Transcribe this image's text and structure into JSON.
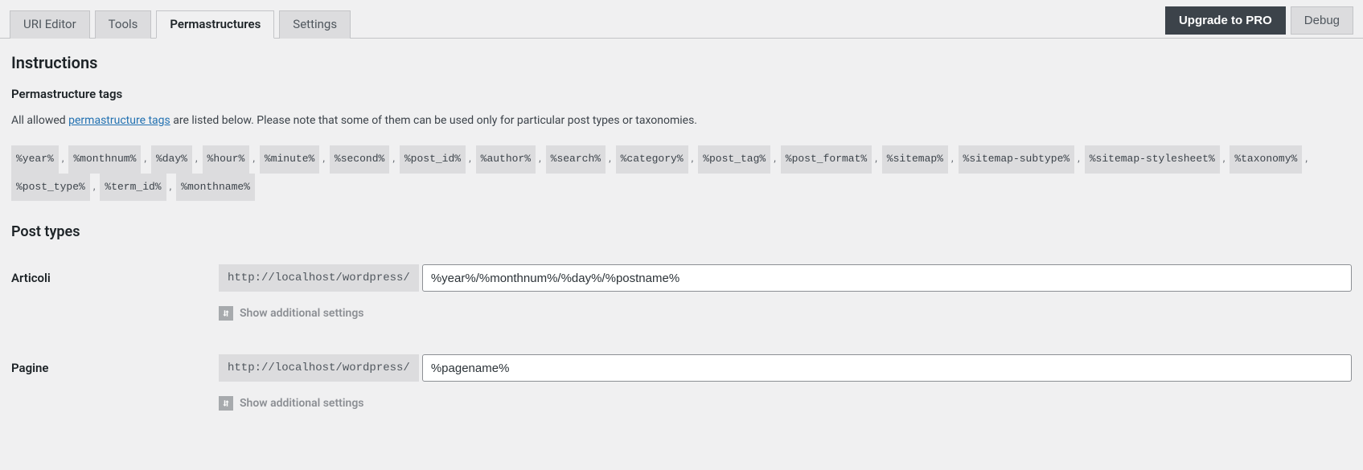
{
  "tabs": {
    "left": [
      "URI Editor",
      "Tools",
      "Permastructures",
      "Settings"
    ],
    "active_index": 2,
    "upgrade": "Upgrade to PRO",
    "debug": "Debug"
  },
  "instructions": {
    "heading": "Instructions",
    "sub_heading": "Permastructure tags",
    "desc_before": "All allowed ",
    "desc_link": "permastructure tags",
    "desc_after": " are listed below. Please note that some of them can be used only for particular post types or taxonomies.",
    "tags": [
      "%year%",
      "%monthnum%",
      "%day%",
      "%hour%",
      "%minute%",
      "%second%",
      "%post_id%",
      "%author%",
      "%search%",
      "%category%",
      "%post_tag%",
      "%post_format%",
      "%sitemap%",
      "%sitemap-subtype%",
      "%sitemap-stylesheet%",
      "%taxonomy%",
      "%post_type%",
      "%term_id%",
      "%monthname%"
    ]
  },
  "post_types": {
    "heading": "Post types",
    "url_prefix": "http://localhost/wordpress/",
    "toggle_label": "Show additional settings",
    "rows": [
      {
        "label": "Articoli",
        "value": "%year%/%monthnum%/%day%/%postname%"
      },
      {
        "label": "Pagine",
        "value": "%pagename%"
      }
    ]
  }
}
